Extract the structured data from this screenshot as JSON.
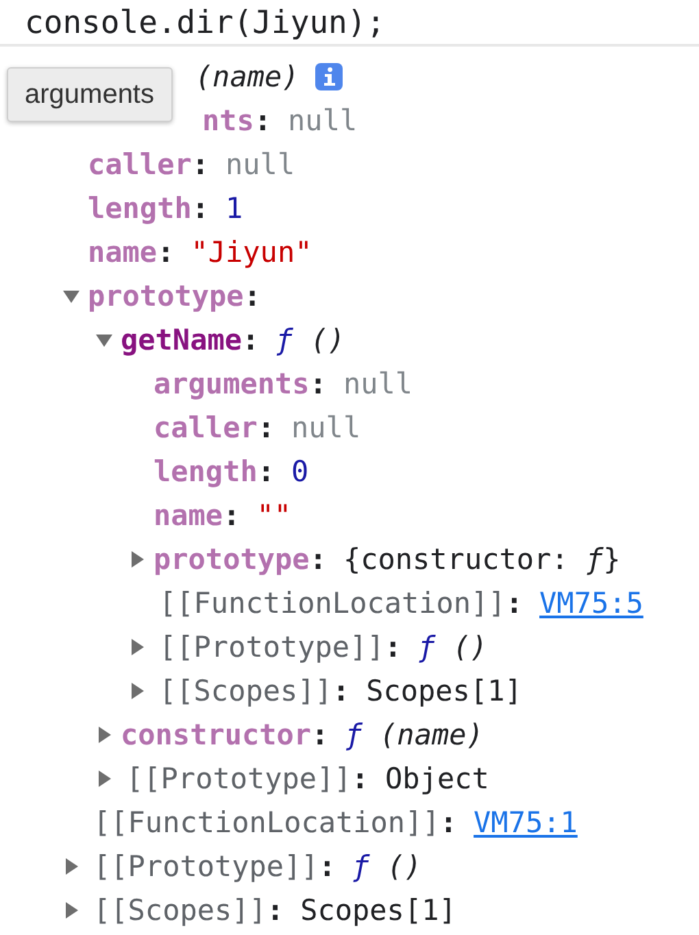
{
  "console_input": "console.dir(Jiyun);",
  "tree": [
    {
      "value": {
        "kind": "signature",
        "text": "(name)"
      },
      "info_badge": true,
      "children": [
        {
          "key": {
            "kind": "clipped_property",
            "text": "nts"
          },
          "separator": ":",
          "value": {
            "kind": "null",
            "text": "null"
          }
        },
        {
          "key": {
            "kind": "property",
            "text": "caller"
          },
          "separator": ":",
          "value": {
            "kind": "null",
            "text": "null"
          }
        },
        {
          "key": {
            "kind": "property",
            "text": "length"
          },
          "separator": ":",
          "value": {
            "kind": "number",
            "text": "1"
          }
        },
        {
          "key": {
            "kind": "property",
            "text": "name"
          },
          "separator": ":",
          "value": {
            "kind": "string",
            "text": "\"Jiyun\""
          }
        },
        {
          "key": {
            "kind": "property",
            "text": "prototype"
          },
          "separator": ":",
          "expanded": true,
          "children": [
            {
              "key": {
                "kind": "own",
                "text": "getName"
              },
              "separator": ":",
              "value": {
                "kind": "function",
                "sign": "ƒ",
                "text": "()"
              },
              "expanded": true,
              "children": [
                {
                  "key": {
                    "kind": "property",
                    "text": "arguments"
                  },
                  "separator": ":",
                  "value": {
                    "kind": "null",
                    "text": "null"
                  }
                },
                {
                  "key": {
                    "kind": "property",
                    "text": "caller"
                  },
                  "separator": ":",
                  "value": {
                    "kind": "null",
                    "text": "null"
                  }
                },
                {
                  "key": {
                    "kind": "property",
                    "text": "length"
                  },
                  "separator": ":",
                  "value": {
                    "kind": "number",
                    "text": "0"
                  }
                },
                {
                  "key": {
                    "kind": "property",
                    "text": "name"
                  },
                  "separator": ":",
                  "value": {
                    "kind": "string",
                    "text": "\"\""
                  }
                },
                {
                  "key": {
                    "kind": "property",
                    "text": "prototype"
                  },
                  "separator": ":",
                  "value": {
                    "kind": "object",
                    "text": "{constructor: *ƒ*}"
                  },
                  "expanded": false
                },
                {
                  "key": {
                    "kind": "internal",
                    "text": "[[FunctionLocation]]"
                  },
                  "separator": ":",
                  "value": {
                    "kind": "link",
                    "text": "VM75:5"
                  }
                },
                {
                  "key": {
                    "kind": "internal",
                    "text": "[[Prototype]]"
                  },
                  "separator": ":",
                  "value": {
                    "kind": "function",
                    "sign": "ƒ",
                    "text": "()"
                  },
                  "expanded": false
                },
                {
                  "key": {
                    "kind": "internal",
                    "text": "[[Scopes]]"
                  },
                  "separator": ":",
                  "value": {
                    "kind": "object",
                    "text": "Scopes[1]"
                  },
                  "expanded": false
                }
              ]
            },
            {
              "key": {
                "kind": "property",
                "text": "constructor"
              },
              "separator": ":",
              "value": {
                "kind": "function",
                "sign": "ƒ",
                "text": "(name)"
              },
              "expanded": false
            },
            {
              "key": {
                "kind": "internal",
                "text": "[[Prototype]]"
              },
              "separator": ":",
              "value": {
                "kind": "object",
                "text": "Object"
              },
              "expanded": false
            }
          ]
        },
        {
          "key": {
            "kind": "internal",
            "text": "[[FunctionLocation]]"
          },
          "separator": ":",
          "value": {
            "kind": "link",
            "text": "VM75:1"
          }
        },
        {
          "key": {
            "kind": "internal",
            "text": "[[Prototype]]"
          },
          "separator": ":",
          "value": {
            "kind": "function",
            "sign": "ƒ",
            "text": "()"
          },
          "expanded": false
        },
        {
          "key": {
            "kind": "internal",
            "text": "[[Scopes]]"
          },
          "separator": ":",
          "value": {
            "kind": "object",
            "text": "Scopes[1]"
          },
          "expanded": false
        }
      ]
    }
  ],
  "tooltip": {
    "text": "arguments"
  }
}
